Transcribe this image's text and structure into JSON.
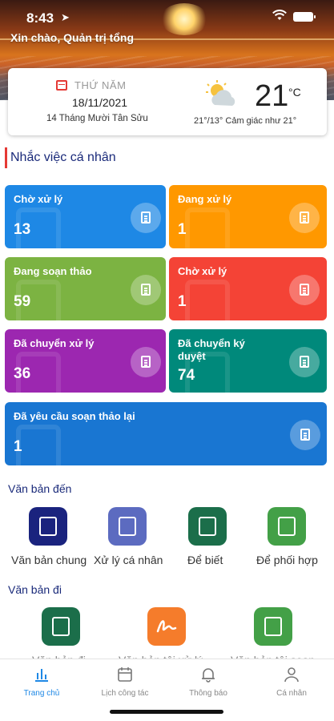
{
  "status": {
    "time": "8:43",
    "location_arrow": "➤",
    "wifi": "wifi-icon"
  },
  "greeting": "Xin chào, Quản trị tổng",
  "info": {
    "day_name": "THỨ NĂM",
    "date": "18/11/2021",
    "lunar_date": "14 Tháng Mười Tân Sửu",
    "temperature": "21",
    "temp_unit": "°C",
    "weather_detail": "21°/13° Cảm giác như 21°",
    "weather_icon": "partly-cloudy-icon"
  },
  "reminder_section": {
    "title": "Nhắc việc cá nhân"
  },
  "tiles": [
    {
      "label": "Chờ xử lý",
      "count": "13",
      "color": "#1e88e5"
    },
    {
      "label": "Đang xử lý",
      "count": "1",
      "color": "#ff9800"
    },
    {
      "label": "Đang soạn thảo",
      "count": "59",
      "color": "#7cb342"
    },
    {
      "label": "Chờ xử lý",
      "count": "1",
      "color": "#f44336"
    },
    {
      "label": "Đã chuyển xử lý",
      "count": "36",
      "color": "#9c27b0"
    },
    {
      "label": "Đã chuyển ký duyệt",
      "count": "74",
      "color": "#00897b"
    },
    {
      "label": "Đã yêu cầu soạn thảo lại",
      "count": "1",
      "color": "#1976d2"
    }
  ],
  "incoming": {
    "title": "Văn bản đến",
    "items": [
      {
        "label": "Văn bản chung",
        "color": "#1a237e",
        "icon": "book-icon"
      },
      {
        "label": "Xử lý cá nhân",
        "color": "#5c6bc0",
        "icon": "contact-book-icon"
      },
      {
        "label": "Để biết",
        "color": "#1b6e4a",
        "icon": "open-book-icon"
      },
      {
        "label": "Để phối hợp",
        "color": "#43a047",
        "icon": "reading-icon"
      }
    ]
  },
  "outgoing": {
    "title": "Văn bản đi",
    "items": [
      {
        "label": "Văn bản đi",
        "color": "#1b6e4a",
        "icon": "upload-document-icon"
      },
      {
        "label": "Văn bản tôi xử lý",
        "color": "#f57c2b",
        "icon": "signature-icon"
      },
      {
        "label": "Văn bản tôi soạn",
        "color": "#43a047",
        "icon": "edit-icon"
      }
    ]
  },
  "tabbar": [
    {
      "label": "Trang chủ",
      "active": true,
      "icon": "chart-icon"
    },
    {
      "label": "Lịch công tác",
      "active": false,
      "icon": "calendar-icon"
    },
    {
      "label": "Thông báo",
      "active": false,
      "icon": "bell-icon"
    },
    {
      "label": "Cá nhân",
      "active": false,
      "icon": "person-icon"
    }
  ]
}
